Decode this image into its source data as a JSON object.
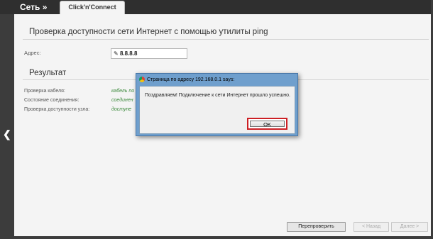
{
  "header": {
    "menu_title": "Сеть »",
    "tab_label": "Click'n'Connect"
  },
  "page": {
    "title": "Проверка доступности сети Интернет с помощью утилиты ping",
    "address_label": "Адрес:",
    "address_value": "8.8.8.8",
    "results_title": "Результат",
    "rows": [
      {
        "label": "Проверка кабеля:",
        "value": "кабель по"
      },
      {
        "label": "Состояние соединения:",
        "value": "соединен"
      },
      {
        "label": "Проверка доступности узла:",
        "value": "доступе"
      }
    ]
  },
  "buttons": {
    "recheck": "Перепроверить",
    "back": "< Назад",
    "next": "Далее >"
  },
  "dialog": {
    "title": "Страница по адресу 192.168.0.1 says:",
    "message": "Поздравляем! Подключение к сети Интернет прошло успешно.",
    "ok_label": "OK"
  },
  "icons": {
    "back_arrow": "chevron-left-icon",
    "dialog_icon": "chrome-icon",
    "pencil": "pencil-icon"
  }
}
